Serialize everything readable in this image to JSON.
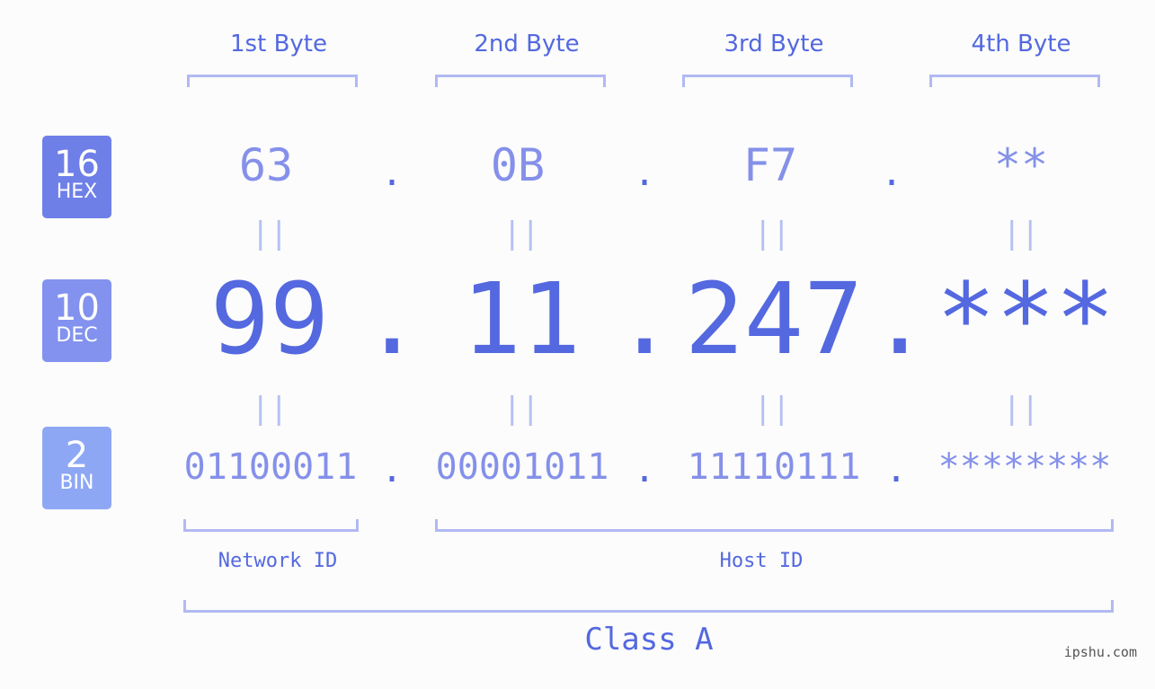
{
  "bytes": {
    "labels": [
      "1st Byte",
      "2nd Byte",
      "3rd Byte",
      "4th Byte"
    ]
  },
  "badges": {
    "hex": {
      "num": "16",
      "label": "HEX",
      "color": "#6f7fe8"
    },
    "dec": {
      "num": "10",
      "label": "DEC",
      "color": "#8292ee"
    },
    "bin": {
      "num": "2",
      "label": "BIN",
      "color": "#8ea7f4"
    }
  },
  "hex": {
    "values": [
      "63",
      "0B",
      "F7",
      "**"
    ]
  },
  "dec": {
    "values": [
      "99",
      "11",
      "247",
      "***"
    ]
  },
  "bin": {
    "values": [
      "01100011",
      "00001011",
      "11110111",
      "********"
    ]
  },
  "separator": ".",
  "equals": "||",
  "ids": {
    "network": "Network ID",
    "host": "Host ID"
  },
  "class_label": "Class A",
  "watermark": "ipshu.com",
  "colors": {
    "accent": "#5468e0",
    "light": "#8590ea",
    "bracket": "#b1b9f3"
  }
}
